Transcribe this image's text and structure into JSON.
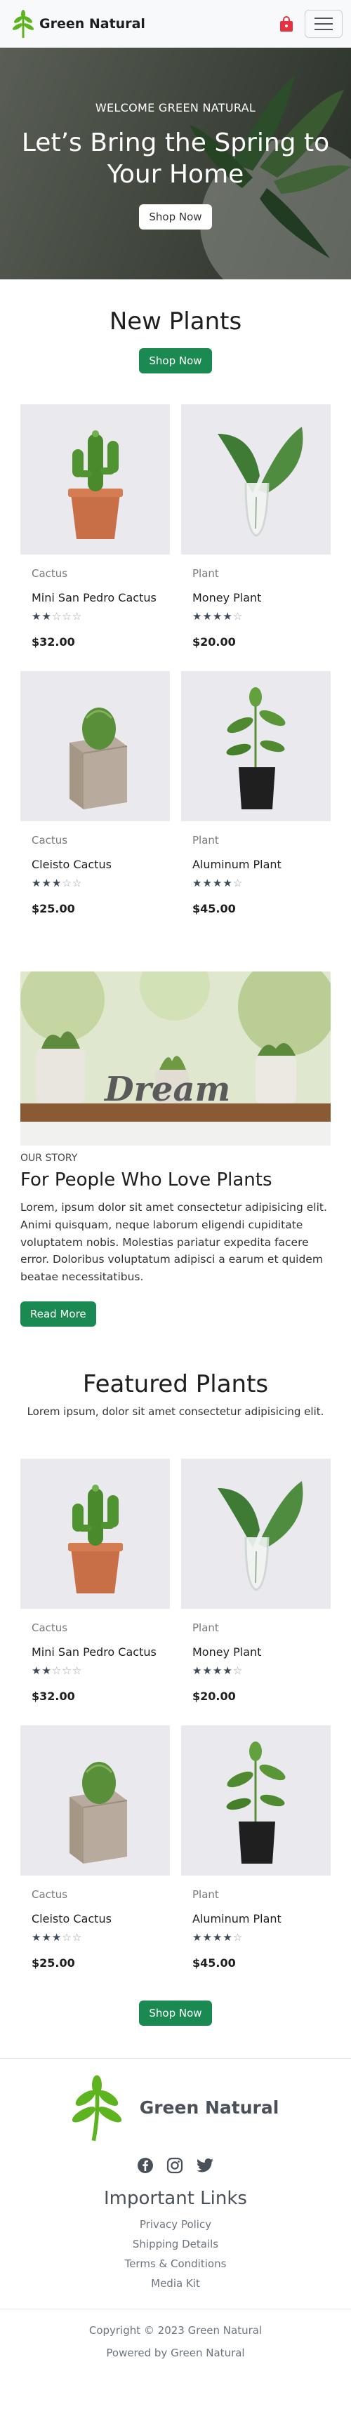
{
  "brand": {
    "name": "Green Natural"
  },
  "hero": {
    "kicker": "WELCOME GREEN NATURAL",
    "title": "Let’s Bring the Spring to Your Home",
    "button": "Shop Now"
  },
  "new_plants": {
    "title": "New Plants",
    "button": "Shop Now",
    "products": [
      {
        "category": "Cactus",
        "name": "Mini San Pedro Cactus",
        "rating": 2,
        "price": "$32.00",
        "image": "potted-cactus"
      },
      {
        "category": "Plant",
        "name": "Money Plant",
        "rating": 4,
        "price": "$20.00",
        "image": "glass-vase-plant"
      },
      {
        "category": "Cactus",
        "name": "Cleisto Cactus",
        "rating": 3,
        "price": "$25.00",
        "image": "cube-pot-cactus"
      },
      {
        "category": "Plant",
        "name": "Aluminum Plant",
        "rating": 4,
        "price": "$45.00",
        "image": "black-bag-plant"
      }
    ]
  },
  "story": {
    "kicker": "OUR STORY",
    "title": "For People Who Love Plants",
    "text": "Lorem, ipsum dolor sit amet consectetur adipisicing elit. Animi quisquam, neque laborum eligendi cupiditate voluptatem nobis. Molestias pariatur expedita facere error. Doloribus voluptatum adipisci a earum et quidem beatae necessitatibus.",
    "button": "Read More",
    "image_word": "Dream"
  },
  "featured": {
    "title": "Featured Plants",
    "subtitle": "Lorem ipsum, dolor sit amet consectetur adipisicing elit.",
    "button": "Shop Now",
    "products": [
      {
        "category": "Cactus",
        "name": "Mini San Pedro Cactus",
        "rating": 2,
        "price": "$32.00",
        "image": "potted-cactus"
      },
      {
        "category": "Plant",
        "name": "Money Plant",
        "rating": 4,
        "price": "$20.00",
        "image": "glass-vase-plant"
      },
      {
        "category": "Cactus",
        "name": "Cleisto Cactus",
        "rating": 3,
        "price": "$25.00",
        "image": "cube-pot-cactus"
      },
      {
        "category": "Plant",
        "name": "Aluminum Plant",
        "rating": 4,
        "price": "$45.00",
        "image": "black-bag-plant"
      }
    ]
  },
  "footer": {
    "brand": "Green Natural",
    "social_icons": [
      "facebook-icon",
      "instagram-icon",
      "twitter-icon"
    ],
    "links_title": "Important Links",
    "links": [
      "Privacy Policy",
      "Shipping Details",
      "Terms & Conditions",
      "Media Kit"
    ],
    "copyright": "Copyright © 2023 Green Natural",
    "powered": "Powered by Green Natural"
  },
  "colors": {
    "accent": "#1b8a52",
    "leaf": "#5db41e",
    "bag": "#e5323e"
  }
}
